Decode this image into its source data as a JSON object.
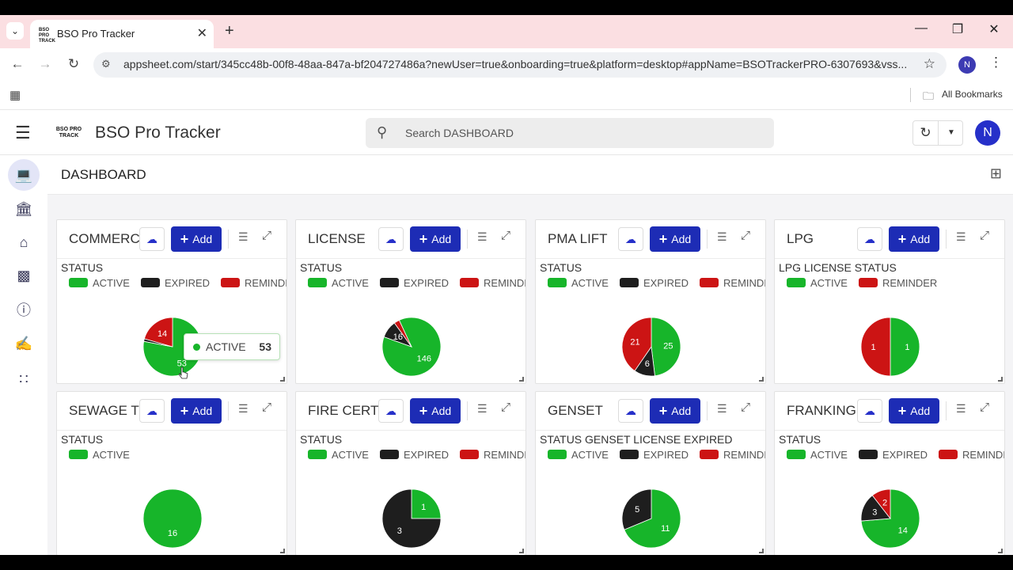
{
  "browser": {
    "tab_title": "BSO Pro Tracker",
    "favicon_text": "BSO PRO TRACK",
    "url": "appsheet.com/start/345cc48b-00f8-48aa-847a-bf204727486a?newUser=true&onboarding=true&platform=desktop#appName=BSOTrackerPRO-6307693&vss...",
    "profile_initial": "N",
    "bookmarks_label": "All Bookmarks"
  },
  "app": {
    "logo_text": "BSO PRO TRACK",
    "title": "BSO Pro Tracker",
    "search_placeholder": "Search DASHBOARD",
    "avatar_initial": "N",
    "accent_color": "#1d2cb5"
  },
  "dashboard": {
    "title": "DASHBOARD",
    "add_label": "Add",
    "colors": {
      "ACTIVE": "#17b52a",
      "EXPIRED": "#1e1e1e",
      "REMINDER": "#cc1414"
    },
    "cards": [
      {
        "title": "COMMERCIAL",
        "chart_label": "STATUS",
        "legend": [
          "ACTIVE",
          "EXPIRED",
          "REMINDER"
        ],
        "slices": [
          {
            "key": "ACTIVE",
            "value": 53
          },
          {
            "key": "EXPIRED",
            "value": 1
          },
          {
            "key": "REMINDER",
            "value": 14
          }
        ],
        "shown_labels": [
          "53",
          "14"
        ]
      },
      {
        "title": "LICENSE",
        "chart_label": "STATUS",
        "legend": [
          "ACTIVE",
          "EXPIRED",
          "REMINDER"
        ],
        "slices": [
          {
            "key": "ACTIVE",
            "value": 146
          },
          {
            "key": "EXPIRED",
            "value": 16
          },
          {
            "key": "REMINDER",
            "value": 5
          }
        ],
        "shown_labels": [
          "146",
          "16"
        ]
      },
      {
        "title": "PMA LIFT",
        "chart_label": "STATUS",
        "legend": [
          "ACTIVE",
          "EXPIRED",
          "REMINDER"
        ],
        "slices": [
          {
            "key": "ACTIVE",
            "value": 25
          },
          {
            "key": "EXPIRED",
            "value": 6
          },
          {
            "key": "REMINDER",
            "value": 21
          }
        ],
        "shown_labels": [
          "25",
          "6",
          "21"
        ]
      },
      {
        "title": "LPG",
        "chart_label": "LPG LICENSE STATUS",
        "legend": [
          "ACTIVE",
          "REMINDER"
        ],
        "slices": [
          {
            "key": "ACTIVE",
            "value": 1
          },
          {
            "key": "REMINDER",
            "value": 1
          }
        ],
        "shown_labels": [
          "1",
          "1"
        ]
      },
      {
        "title": "SEWAGE TREATMENT",
        "chart_label": "STATUS",
        "legend": [
          "ACTIVE"
        ],
        "slices": [
          {
            "key": "ACTIVE",
            "value": 16
          }
        ],
        "shown_labels": [
          "16"
        ]
      },
      {
        "title": "FIRE CERT",
        "chart_label": "STATUS",
        "legend": [
          "ACTIVE",
          "EXPIRED",
          "REMINDER"
        ],
        "slices": [
          {
            "key": "ACTIVE",
            "value": 1
          },
          {
            "key": "EXPIRED",
            "value": 3
          }
        ],
        "shown_labels": [
          "1",
          "3"
        ]
      },
      {
        "title": "GENSET",
        "chart_label": "STATUS GENSET LICENSE EXPIRED",
        "legend": [
          "ACTIVE",
          "EXPIRED",
          "REMINDER"
        ],
        "slices": [
          {
            "key": "ACTIVE",
            "value": 11
          },
          {
            "key": "EXPIRED",
            "value": 5
          }
        ],
        "shown_labels": [
          "11",
          "5"
        ]
      },
      {
        "title": "FRANKING",
        "chart_label": "STATUS",
        "legend": [
          "ACTIVE",
          "EXPIRED",
          "REMINDER"
        ],
        "slices": [
          {
            "key": "ACTIVE",
            "value": 14
          },
          {
            "key": "EXPIRED",
            "value": 3
          },
          {
            "key": "REMINDER",
            "value": 2
          }
        ],
        "shown_labels": [
          "14",
          "3",
          "2"
        ]
      }
    ],
    "tooltip": {
      "label": "ACTIVE",
      "value": "53"
    }
  },
  "chart_data": [
    {
      "type": "pie",
      "title": "STATUS",
      "categories": [
        "ACTIVE",
        "EXPIRED",
        "REMINDER"
      ],
      "values": [
        53,
        1,
        14
      ]
    },
    {
      "type": "pie",
      "title": "STATUS",
      "categories": [
        "ACTIVE",
        "EXPIRED",
        "REMINDER"
      ],
      "values": [
        146,
        16,
        5
      ]
    },
    {
      "type": "pie",
      "title": "STATUS",
      "categories": [
        "ACTIVE",
        "EXPIRED",
        "REMINDER"
      ],
      "values": [
        25,
        6,
        21
      ]
    },
    {
      "type": "pie",
      "title": "LPG LICENSE STATUS",
      "categories": [
        "ACTIVE",
        "REMINDER"
      ],
      "values": [
        1,
        1
      ]
    },
    {
      "type": "pie",
      "title": "STATUS",
      "categories": [
        "ACTIVE"
      ],
      "values": [
        16
      ]
    },
    {
      "type": "pie",
      "title": "STATUS",
      "categories": [
        "ACTIVE",
        "EXPIRED"
      ],
      "values": [
        1,
        3
      ]
    },
    {
      "type": "pie",
      "title": "STATUS GENSET LICENSE EXPIRED",
      "categories": [
        "ACTIVE",
        "EXPIRED"
      ],
      "values": [
        11,
        5
      ]
    },
    {
      "type": "pie",
      "title": "STATUS",
      "categories": [
        "ACTIVE",
        "EXPIRED",
        "REMINDER"
      ],
      "values": [
        14,
        3,
        2
      ]
    }
  ]
}
